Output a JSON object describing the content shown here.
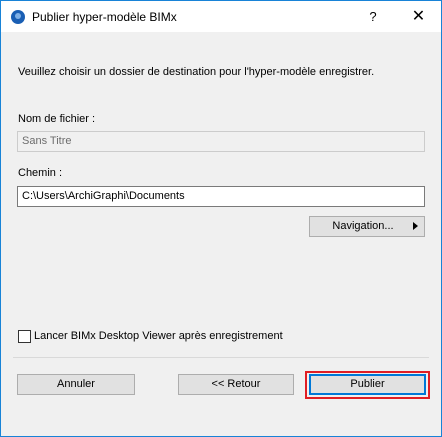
{
  "window": {
    "title": "Publier hyper-modèle BIMx",
    "help_label": "?",
    "close_label": "✕"
  },
  "instruction": "Veuillez choisir un dossier de destination pour l'hyper-modèle enregistrer.",
  "filename": {
    "label": "Nom de fichier :",
    "value": "Sans Titre"
  },
  "path": {
    "label": "Chemin :",
    "value": "C:\\Users\\ArchiGraphi\\Documents"
  },
  "navigation_button": "Navigation...",
  "checkbox": {
    "label": "Lancer BIMx Desktop Viewer après enregistrement",
    "checked": false
  },
  "footer": {
    "cancel": "Annuler",
    "back": "<< Retour",
    "publish": "Publier"
  },
  "colors": {
    "window_border": "#1883d7",
    "highlight": "#e01e24",
    "default_button_border": "#0078d7"
  },
  "icons": {
    "app": "bimx-app-icon",
    "navigation_arrow": "triangle-right-icon"
  }
}
